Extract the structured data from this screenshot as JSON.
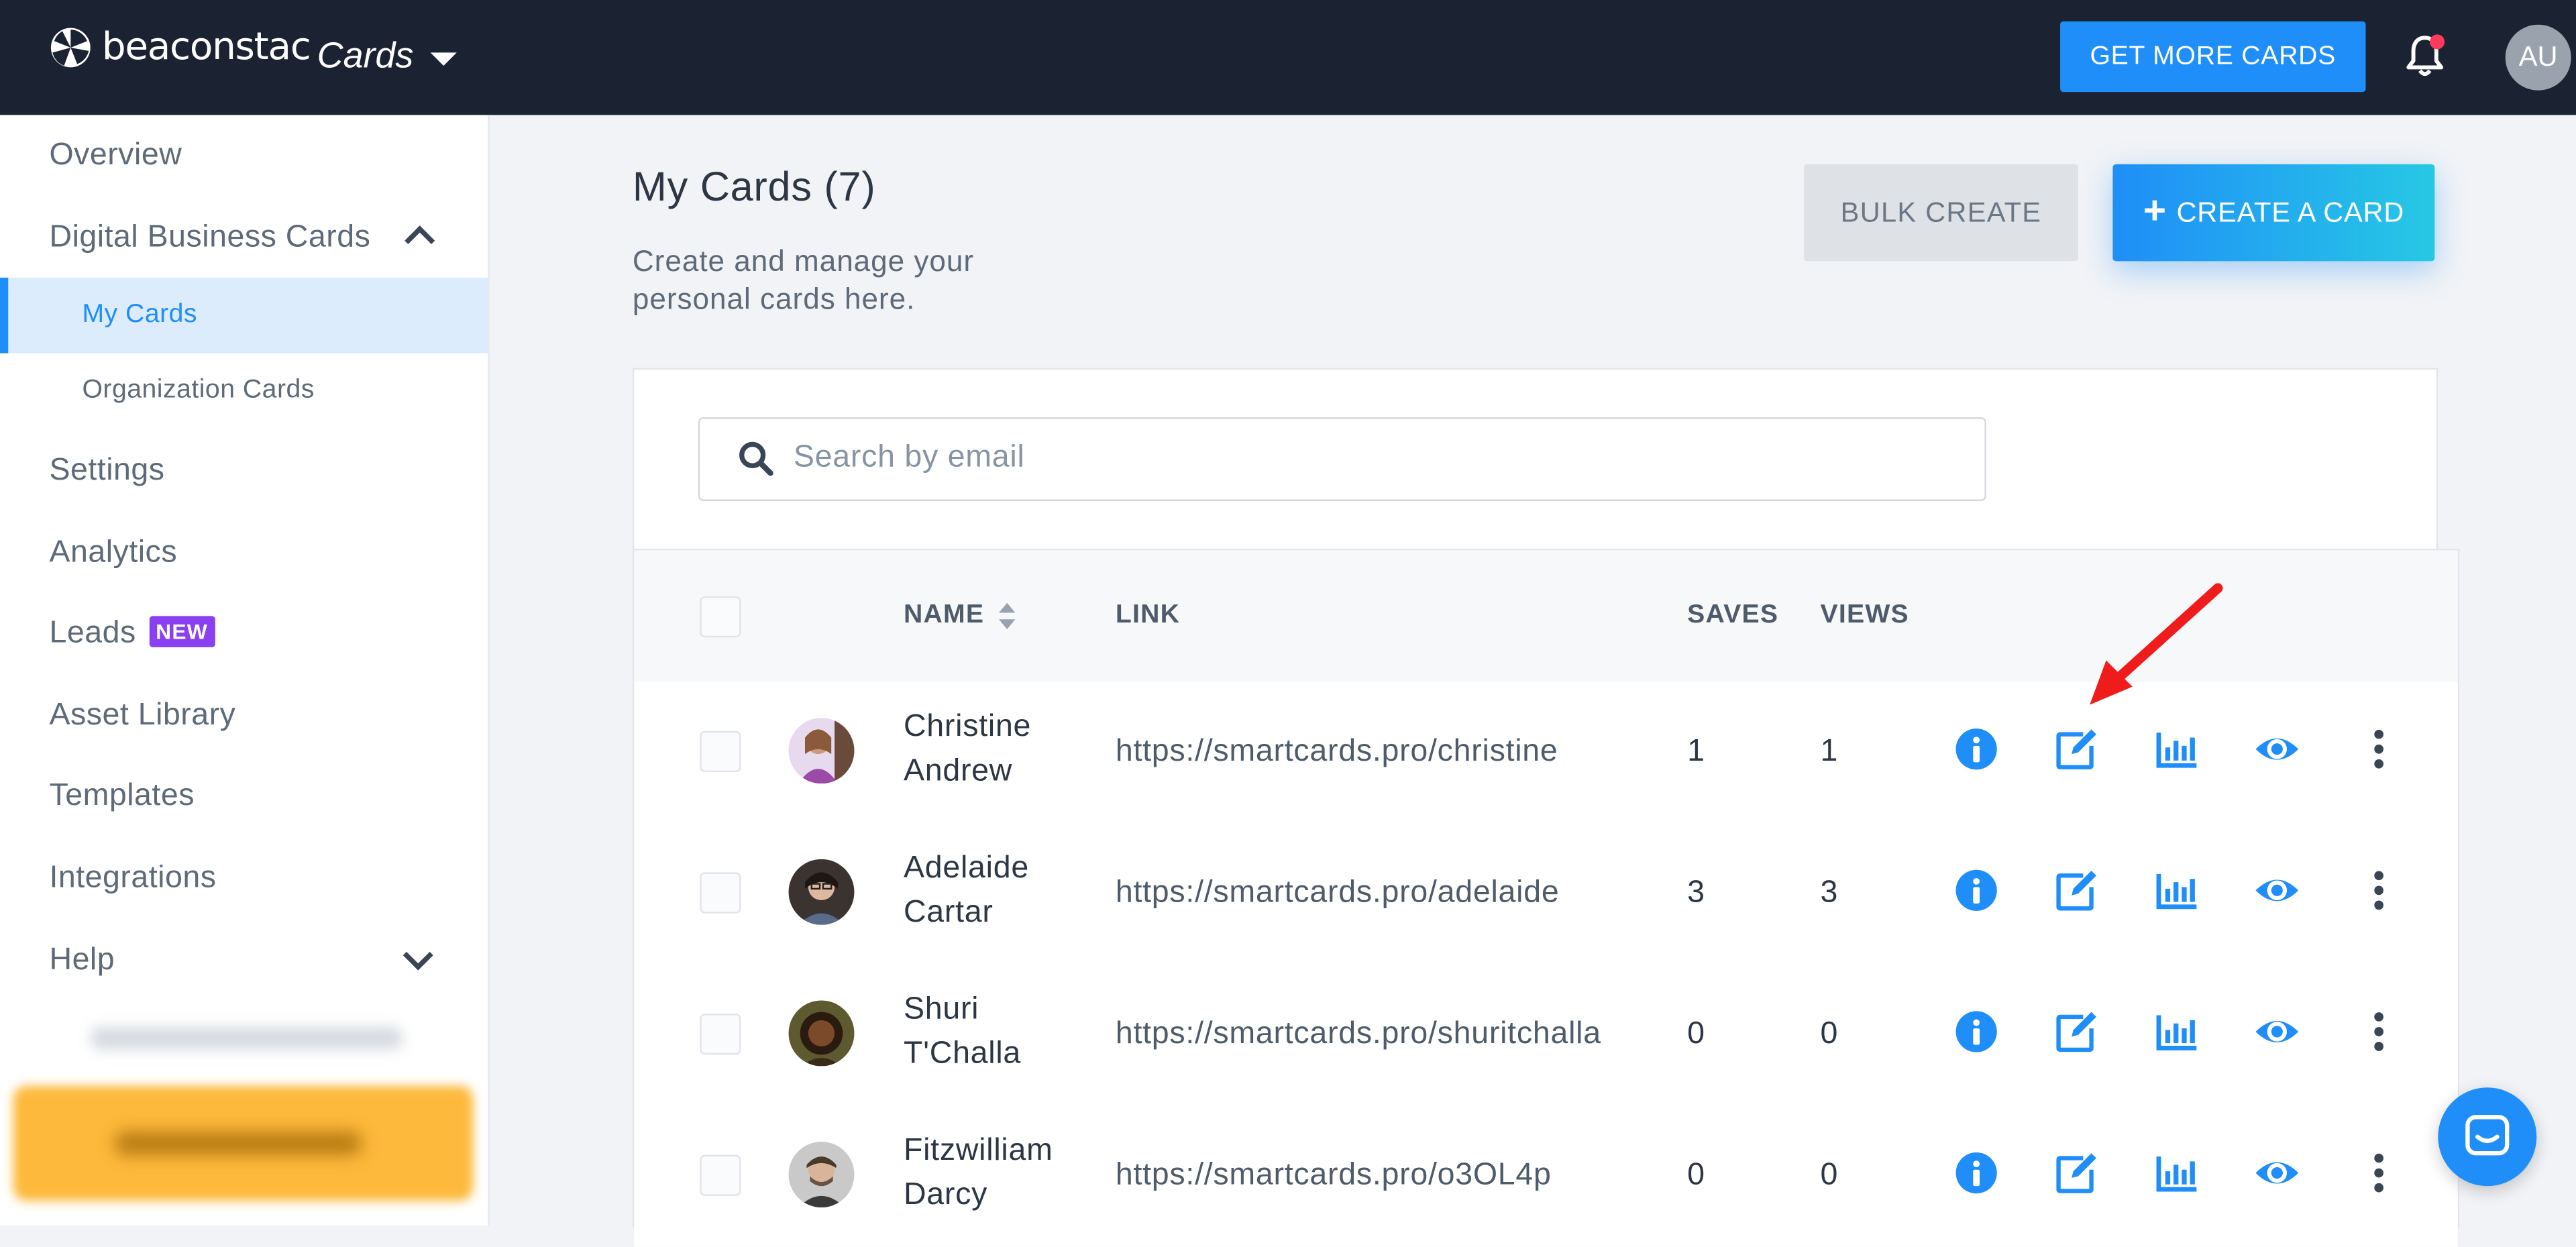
{
  "header": {
    "brand": "beaconstac",
    "section": "Cards",
    "get_more_label": "GET MORE CARDS",
    "avatar_initials": "AU"
  },
  "sidebar": {
    "overview": "Overview",
    "digital_business_cards": "Digital Business Cards",
    "my_cards": "My Cards",
    "organization_cards": "Organization Cards",
    "settings": "Settings",
    "analytics": "Analytics",
    "leads": "Leads",
    "leads_badge": "NEW",
    "asset_library": "Asset Library",
    "templates": "Templates",
    "integrations": "Integrations",
    "help": "Help"
  },
  "main": {
    "title": "My Cards (7)",
    "subtitle": "Create and manage your personal cards here.",
    "bulk_create_label": "BULK CREATE",
    "create_label": "CREATE A CARD",
    "search_placeholder": "Search by email"
  },
  "table": {
    "headers": {
      "name": "NAME",
      "link": "LINK",
      "saves": "SAVES",
      "views": "VIEWS"
    },
    "rows": [
      {
        "name": "Christine Andrew",
        "link": "https://smartcards.pro/christine",
        "saves": "1",
        "views": "1"
      },
      {
        "name": "Adelaide Cartar",
        "link": "https://smartcards.pro/adelaide",
        "saves": "3",
        "views": "3"
      },
      {
        "name": "Shuri T'Challa",
        "link": "https://smartcards.pro/shuritchalla",
        "saves": "0",
        "views": "0"
      },
      {
        "name": "Fitzwilliam Darcy",
        "link": "https://smartcards.pro/o3OL4p",
        "saves": "0",
        "views": "0"
      }
    ]
  },
  "colors": {
    "topbar": "#1b2332",
    "accent": "#1f8ef8",
    "active_bg": "#dcecfd",
    "badge_new": "#8a3ff0",
    "annotation_arrow": "#f01c1c"
  }
}
